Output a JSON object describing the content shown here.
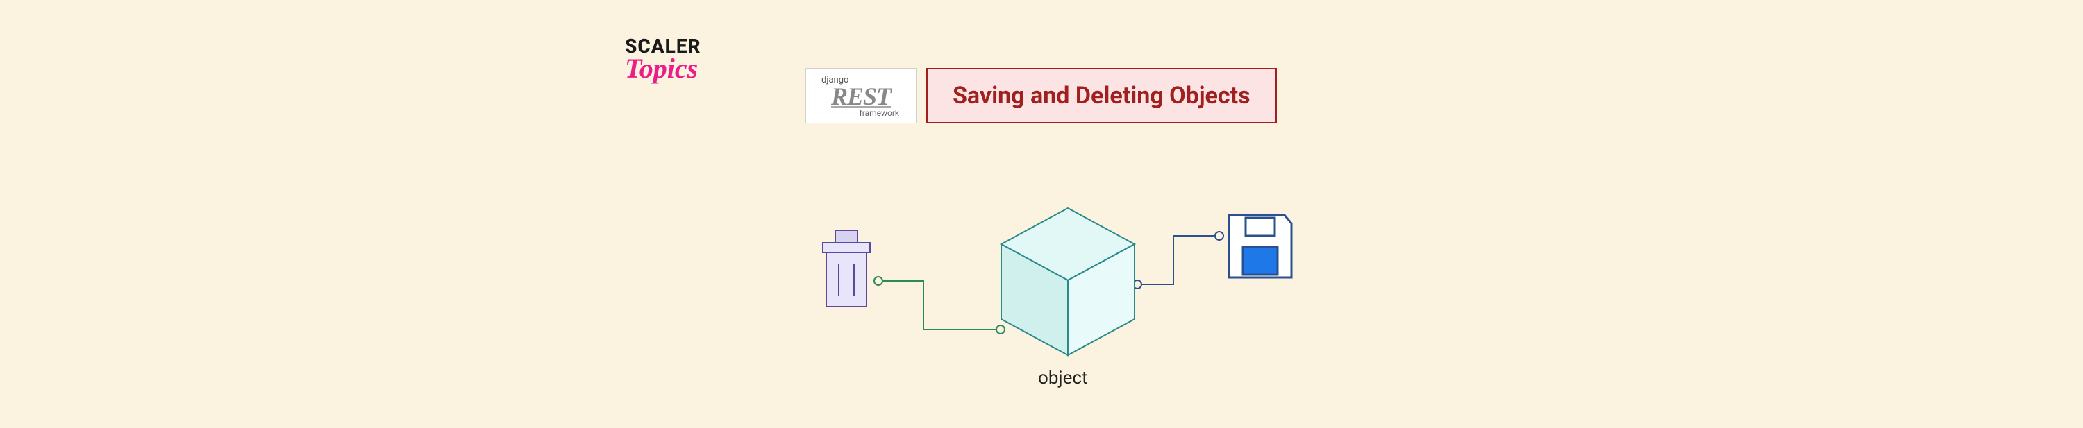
{
  "logo": {
    "line1": "SCALER",
    "line2": "Topics"
  },
  "badge": {
    "top": "django",
    "main": "REST",
    "bottom": "framework"
  },
  "title": "Saving and Deleting Objects",
  "diagram": {
    "object_label": "object",
    "nodes": {
      "left": "trash-bin",
      "center": "cube",
      "right": "save-floppy"
    }
  },
  "colors": {
    "bg": "#fbf2e0",
    "accent": "#a02020",
    "title_bg": "#fce4e4",
    "cube_fill": "#e2f8f7",
    "cube_stroke": "#2a8a8a",
    "trash_fill": "#e8e4fa",
    "trash_stroke": "#5a4a9a",
    "save_stroke": "#2a5090",
    "save_fill": "#1e78e8",
    "conn_green": "#2a8a5a",
    "conn_blue": "#2a5090"
  }
}
